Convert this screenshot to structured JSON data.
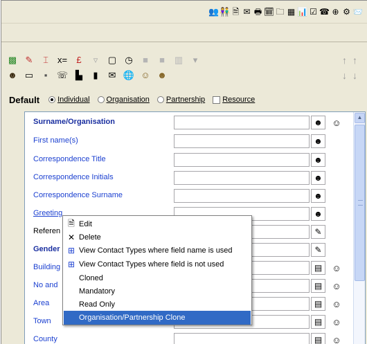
{
  "top_toolbar": {
    "icons": [
      {
        "name": "contacts-icon",
        "glyph": "👥"
      },
      {
        "name": "people-icon",
        "glyph": "👫"
      },
      {
        "name": "document-icon",
        "glyph": "🗎"
      },
      {
        "name": "letter-icon",
        "glyph": "✉"
      },
      {
        "name": "print-icon",
        "glyph": "🖶"
      },
      {
        "name": "calendar-icon",
        "glyph": "🗓"
      },
      {
        "name": "folder-icon",
        "glyph": "🗀"
      },
      {
        "name": "scan-icon",
        "glyph": "▦"
      },
      {
        "name": "report-icon",
        "glyph": "📊"
      },
      {
        "name": "checklist-icon",
        "glyph": "☑"
      },
      {
        "name": "phone-icon",
        "glyph": "☎"
      },
      {
        "name": "globe-icon",
        "glyph": "⊕"
      },
      {
        "name": "settings-icon",
        "glyph": "⚙"
      },
      {
        "name": "mail-icon",
        "glyph": "📨"
      }
    ]
  },
  "toolbar2": {
    "row1": [
      {
        "name": "hierarchy-icon",
        "glyph": "▩",
        "color": "#2a8a2a"
      },
      {
        "name": "pencil-icon",
        "glyph": "✎",
        "color": "#c03030"
      },
      {
        "name": "bracket-icon",
        "glyph": "⌶",
        "color": "#c03030"
      },
      {
        "name": "x-equals-icon",
        "glyph": "x=",
        "color": "#000000"
      },
      {
        "name": "pound-icon",
        "glyph": "£",
        "color": "#c02020"
      },
      {
        "name": "filter-icon",
        "glyph": "▿",
        "color": "#a9a9a9"
      },
      {
        "name": "square-icon",
        "glyph": "▢",
        "color": "#000000"
      },
      {
        "name": "clock-icon",
        "glyph": "◷",
        "color": "#000000"
      },
      {
        "name": "block-icon",
        "glyph": "■",
        "color": "#b5b5b5"
      },
      {
        "name": "block2-icon",
        "glyph": "■",
        "color": "#b5b5b5"
      },
      {
        "name": "columns-icon",
        "glyph": "▥",
        "color": "#b5b5b5"
      },
      {
        "name": "dropdown-icon",
        "glyph": "▾",
        "color": "#a9a9a9"
      }
    ],
    "row2": [
      {
        "name": "person-icon",
        "glyph": "☻",
        "color": "#3a2a10"
      },
      {
        "name": "card-icon",
        "glyph": "▭",
        "color": "#000000"
      },
      {
        "name": "fax-icon",
        "glyph": "▪",
        "color": "#555555"
      },
      {
        "name": "phone-icon",
        "glyph": "☏",
        "color": "#000000"
      },
      {
        "name": "building-icon",
        "glyph": "▙",
        "color": "#000000"
      },
      {
        "name": "mobile-icon",
        "glyph": "▮",
        "color": "#000000"
      },
      {
        "name": "email-icon",
        "glyph": "✉",
        "color": "#000000"
      },
      {
        "name": "globe-icon",
        "glyph": "🌐",
        "color": "#2060c0"
      },
      {
        "name": "people-icon",
        "glyph": "☺",
        "color": "#806020"
      },
      {
        "name": "person2-icon",
        "glyph": "☻",
        "color": "#806020"
      }
    ],
    "arrows_row1": [
      "↑",
      "↑"
    ],
    "arrows_row2": [
      "↓",
      "↓"
    ]
  },
  "mode_bar": {
    "title": "Default",
    "options": [
      {
        "label": "Individual",
        "selected": true
      },
      {
        "label": "Organisation",
        "selected": false
      },
      {
        "label": "Partnership",
        "selected": false
      }
    ],
    "checkbox_label": "Resource"
  },
  "fields": [
    {
      "label": "Surname/Organisation",
      "style": "bold",
      "btn": "☻",
      "side": "☺"
    },
    {
      "label": "First name(s)",
      "style": "",
      "btn": "☻",
      "side": ""
    },
    {
      "label": "Correspondence Title",
      "style": "",
      "btn": "☻",
      "side": ""
    },
    {
      "label": "Correspondence Initials",
      "style": "",
      "btn": "☻",
      "side": ""
    },
    {
      "label": "Correspondence Surname",
      "style": "",
      "btn": "☻",
      "side": ""
    },
    {
      "label": "Greeting",
      "style": "underline",
      "btn": "☻",
      "side": ""
    },
    {
      "label": "Referen",
      "style": "black",
      "btn": "✎",
      "side": ""
    },
    {
      "label": "Gender",
      "style": "bold",
      "btn": "✎",
      "side": ""
    },
    {
      "label": "Building",
      "style": "",
      "btn": "▤",
      "side": "☺"
    },
    {
      "label": "No and",
      "style": "",
      "btn": "▤",
      "side": "☺"
    },
    {
      "label": "Area",
      "style": "",
      "btn": "▤",
      "side": "☺"
    },
    {
      "label": "Town",
      "style": "",
      "btn": "▤",
      "side": "☺"
    },
    {
      "label": "County",
      "style": "",
      "btn": "▤",
      "side": "☺"
    }
  ],
  "context_menu": {
    "items": [
      {
        "label": "Edit",
        "icon": "🗎",
        "icon_name": "edit-icon",
        "selected": false
      },
      {
        "label": "Delete",
        "icon": "✕",
        "icon_name": "delete-icon",
        "selected": false
      },
      {
        "label": "View Contact Types where field name is used",
        "icon": "⊞",
        "icon_name": "tree-icon",
        "selected": false
      },
      {
        "label": "View Contact Types where field is not used",
        "icon": "⊞",
        "icon_name": "tree-icon",
        "selected": false
      },
      {
        "label": "Cloned",
        "icon": "",
        "icon_name": "",
        "selected": false
      },
      {
        "label": "Mandatory",
        "icon": "",
        "icon_name": "",
        "selected": false
      },
      {
        "label": "Read Only",
        "icon": "",
        "icon_name": "",
        "selected": false
      },
      {
        "label": "Organisation/Partnership Clone",
        "icon": "",
        "icon_name": "",
        "selected": true
      }
    ]
  },
  "colors": {
    "field_label": "#1a3fd0",
    "menu_highlight": "#316ac5",
    "chrome": "#ece9d8"
  }
}
